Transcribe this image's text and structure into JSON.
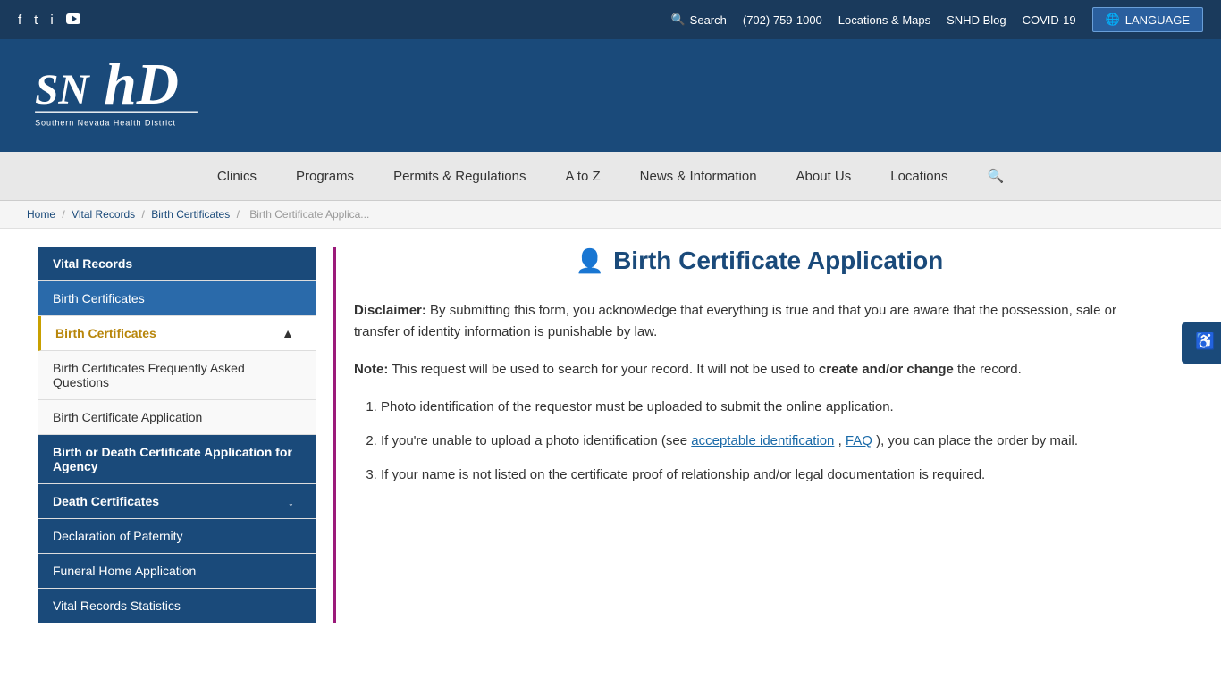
{
  "utilityBar": {
    "social": [
      {
        "name": "facebook",
        "icon": "f",
        "label": "Facebook"
      },
      {
        "name": "twitter",
        "icon": "𝕏",
        "label": "Twitter"
      },
      {
        "name": "instagram",
        "icon": "📷",
        "label": "Instagram"
      },
      {
        "name": "youtube",
        "icon": "▶",
        "label": "YouTube"
      }
    ],
    "links": [
      {
        "label": "Search",
        "icon": "🔍",
        "name": "search-link"
      },
      {
        "label": "(702) 759-1000",
        "name": "phone-link"
      },
      {
        "label": "Locations & Maps",
        "name": "locations-maps-link"
      },
      {
        "label": "SNHD Blog",
        "name": "blog-link"
      },
      {
        "label": "COVID-19",
        "name": "covid-link"
      }
    ],
    "languageBtn": "LANGUAGE"
  },
  "header": {
    "logoAlt": "Southern Nevada Health District",
    "logoText": "SNHD"
  },
  "mainNav": {
    "items": [
      {
        "label": "Clinics",
        "name": "nav-clinics"
      },
      {
        "label": "Programs",
        "name": "nav-programs"
      },
      {
        "label": "Permits & Regulations",
        "name": "nav-permits"
      },
      {
        "label": "A to Z",
        "name": "nav-atoz"
      },
      {
        "label": "News & Information",
        "name": "nav-news"
      },
      {
        "label": "About Us",
        "name": "nav-about"
      },
      {
        "label": "Locations",
        "name": "nav-locations"
      }
    ]
  },
  "breadcrumb": {
    "items": [
      {
        "label": "Home",
        "name": "breadcrumb-home"
      },
      {
        "label": "Vital Records",
        "name": "breadcrumb-vital"
      },
      {
        "label": "Birth Certificates",
        "name": "breadcrumb-birth"
      },
      {
        "label": "Birth Certificate Applica...",
        "name": "breadcrumb-current"
      }
    ]
  },
  "sidebar": {
    "items": [
      {
        "label": "Vital Records",
        "type": "top",
        "name": "sidebar-vital-records"
      },
      {
        "label": "Birth Certificates",
        "type": "sub-top",
        "name": "sidebar-birth-certs"
      },
      {
        "label": "Birth Certificates",
        "type": "active-gold",
        "arrow": "▲",
        "name": "sidebar-birth-certs-active"
      },
      {
        "label": "Birth Certificates Frequently Asked Questions",
        "type": "sub",
        "name": "sidebar-faq"
      },
      {
        "label": "Birth Certificate Application",
        "type": "sub",
        "name": "sidebar-birth-app"
      },
      {
        "label": "Birth or Death Certificate Application for Agency",
        "type": "highlight",
        "name": "sidebar-agency-app"
      },
      {
        "label": "Death Certificates",
        "type": "highlight2",
        "arrow": "↓",
        "name": "sidebar-death-certs"
      },
      {
        "label": "Declaration of Paternity",
        "type": "highlight3",
        "name": "sidebar-paternity"
      },
      {
        "label": "Funeral Home Application",
        "type": "highlight3",
        "name": "sidebar-funeral"
      },
      {
        "label": "Vital Records Statistics",
        "type": "highlight3",
        "name": "sidebar-statistics"
      }
    ]
  },
  "pageContent": {
    "title": "Birth Certificate Application",
    "disclaimer": {
      "label": "Disclaimer:",
      "text": " By submitting this form, you acknowledge that everything is true and that you are aware that the possession, sale or transfer of identity information is punishable by law."
    },
    "note": {
      "label": "Note:",
      "text": " This request will be used to search for your record. It will not be used to ",
      "boldText": "create and/or change",
      "text2": " the record."
    },
    "listItems": [
      {
        "text": "Photo identification of the requestor must be uploaded to submit the online application.",
        "name": "list-item-1"
      },
      {
        "text1": "If you're unable to upload a photo identification (see ",
        "linkText1": "acceptable identification",
        "linkSep": ", ",
        "linkText2": "FAQ",
        "text2": "), you can place the order by mail.",
        "name": "list-item-2"
      },
      {
        "text": "If your name is not listed on the certificate proof of relationship and/or legal documentation is required.",
        "name": "list-item-3"
      }
    ]
  },
  "accessibility": {
    "label": "Accessibility"
  }
}
